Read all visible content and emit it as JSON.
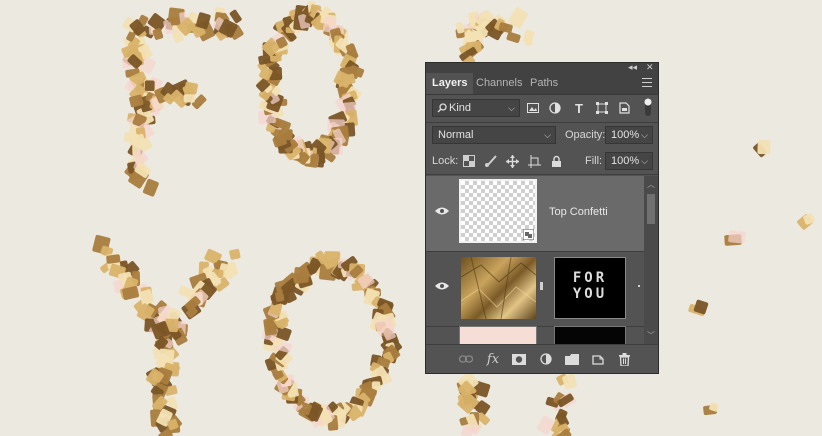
{
  "canvas": {
    "background": "#ece9e1",
    "text_line1": "FOR",
    "text_line2": "YOU",
    "confetti_colors": [
      "#a97d3e",
      "#d9b36a",
      "#7a5526",
      "#f3e2b4",
      "#f6d4cf"
    ]
  },
  "panel": {
    "collapse_glyph": "◂◂",
    "close_glyph": "✕",
    "tabs": [
      {
        "label": "Layers",
        "active": true
      },
      {
        "label": "Channels",
        "active": false
      },
      {
        "label": "Paths",
        "active": false
      }
    ],
    "filter": {
      "value": "Kind",
      "icon": "search-icon"
    },
    "filter_icons": [
      "image-filter-icon",
      "adjustment-filter-icon",
      "type-filter-icon",
      "shape-filter-icon",
      "smart-object-filter-icon",
      "filter-toggle-icon"
    ],
    "blend_mode": "Normal",
    "opacity_label": "Opacity:",
    "opacity_value": "100%",
    "lock_label": "Lock:",
    "lock_icons": [
      "lock-transparent-pixels-icon",
      "lock-image-pixels-icon",
      "lock-position-icon",
      "lock-artboard-icon",
      "lock-all-icon"
    ],
    "fill_label": "Fill:",
    "fill_value": "100%",
    "layers": [
      {
        "name": "Top Confetti",
        "visible": true,
        "selected": true
      },
      {
        "name": "",
        "visible": true,
        "selected": false,
        "mask_text_1": "FOR",
        "mask_text_2": "YOU"
      }
    ],
    "bottom_icons": [
      "link-layers-icon",
      "fx-icon",
      "add-mask-icon",
      "adjustment-layer-icon",
      "group-folder-icon",
      "new-layer-icon",
      "trash-icon"
    ],
    "fx_label": "fx"
  }
}
